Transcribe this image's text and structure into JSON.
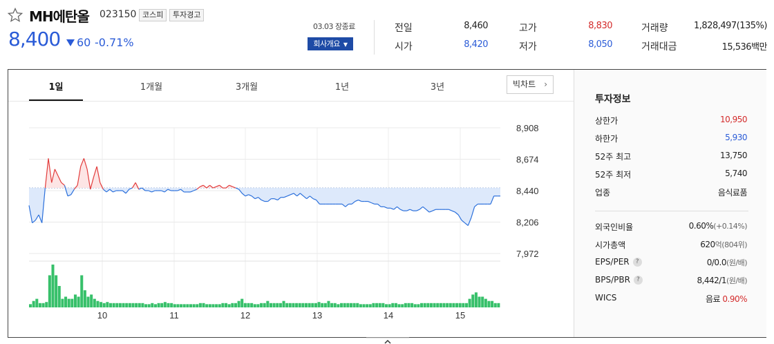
{
  "stock": {
    "name": "MH에탄올",
    "code": "023150",
    "market_tag": "코스피",
    "warning_tag": "투자경고",
    "price": "8,400",
    "change": "60",
    "change_pct": "-0.71%",
    "close_label": "03.03 장종료",
    "company_button": "회사개요"
  },
  "quote": {
    "prev_label": "전일",
    "prev": "8,460",
    "open_label": "시가",
    "open": "8,420",
    "high_label": "고가",
    "high": "8,830",
    "low_label": "저가",
    "low": "8,050",
    "volume_label": "거래량",
    "volume": "1,828,497(135%)",
    "amount_label": "거래대금",
    "amount": "15,536백만"
  },
  "tabs": [
    "1일",
    "1개월",
    "3개월",
    "1년",
    "3년"
  ],
  "big_chart_button": "빅차트",
  "invest": {
    "title": "투자정보",
    "rows": [
      {
        "label": "상한가",
        "value": "10,950"
      },
      {
        "label": "하한가",
        "value": "5,930"
      },
      {
        "label": "52주 최고",
        "value": "13,750"
      },
      {
        "label": "52주 최저",
        "value": "5,740"
      },
      {
        "label": "업종",
        "value": "음식료품"
      },
      {
        "label": "외국인비율",
        "value": "0.60%",
        "sub": "(+0.14%)"
      },
      {
        "label": "시가총액",
        "value": "620",
        "sub": "억(804위)"
      },
      {
        "label": "EPS/PER",
        "value": "0/0.0",
        "sub": "(원/배)"
      },
      {
        "label": "BPS/PBR",
        "value": "8,442/1",
        "sub": "(원/배)"
      },
      {
        "label": "WICS",
        "value": "음료",
        "sub": "0.90%"
      }
    ]
  },
  "chart_data": {
    "type": "line",
    "title": "",
    "xlabel": "",
    "ylabel": "",
    "x_ticks": [
      "10",
      "11",
      "12",
      "13",
      "14",
      "15"
    ],
    "y_ticks": [
      "8,908",
      "8,674",
      "8,440",
      "8,206",
      "7,972"
    ],
    "ylim": [
      7972,
      8908
    ],
    "baseline": 8460,
    "colors": {
      "up": "#e23b3b",
      "down": "#2a6fdb",
      "volume": "#37c06a"
    },
    "series": [
      {
        "name": "",
        "values": [
          8330,
          8200,
          8220,
          8260,
          8200,
          8460,
          8680,
          8500,
          8600,
          8550,
          8500,
          8480,
          8400,
          8410,
          8450,
          8480,
          8620,
          8680,
          8600,
          8450,
          8540,
          8620,
          8500,
          8450,
          8430,
          8450,
          8430,
          8440,
          8440,
          8440,
          8420,
          8450,
          8460,
          8500,
          8450,
          8460,
          8440,
          8440,
          8430,
          8440,
          8440,
          8440,
          8430,
          8450,
          8440,
          8440,
          8440,
          8450,
          8430,
          8430,
          8430,
          8440,
          8450,
          8470,
          8480,
          8460,
          8480,
          8460,
          8470,
          8480,
          8460,
          8460,
          8480,
          8470,
          8460,
          8450,
          8420,
          8400,
          8410,
          8400,
          8380,
          8390,
          8370,
          8360,
          8360,
          8380,
          8380,
          8370,
          8390,
          8390,
          8400,
          8410,
          8420,
          8400,
          8420,
          8400,
          8380,
          8400,
          8380,
          8370,
          8340,
          8340,
          8340,
          8340,
          8340,
          8340,
          8340,
          8340,
          8320,
          8340,
          8340,
          8360,
          8370,
          8360,
          8360,
          8360,
          8350,
          8340,
          8340,
          8320,
          8320,
          8310,
          8310,
          8300,
          8320,
          8300,
          8290,
          8290,
          8300,
          8290,
          8290,
          8300,
          8320,
          8300,
          8280,
          8290,
          8300,
          8300,
          8300,
          8300,
          8300,
          8290,
          8280,
          8260,
          8220,
          8200,
          8180,
          8240,
          8320,
          8340,
          8340,
          8340,
          8340,
          8340,
          8400,
          8400,
          8400
        ]
      },
      {
        "name": "",
        "type": "volume",
        "values": [
          3,
          6,
          8,
          4,
          4,
          5,
          30,
          40,
          30,
          20,
          8,
          10,
          8,
          8,
          12,
          10,
          30,
          16,
          10,
          12,
          8,
          6,
          5,
          4,
          5,
          4,
          4,
          4,
          4,
          4,
          4,
          4,
          4,
          4,
          4,
          4,
          3,
          3,
          4,
          3,
          4,
          4,
          5,
          4,
          4,
          3,
          3,
          3,
          3,
          3,
          3,
          3,
          3,
          4,
          4,
          3,
          3,
          3,
          3,
          3,
          4,
          4,
          3,
          4,
          4,
          6,
          8,
          4,
          4,
          4,
          3,
          3,
          4,
          4,
          6,
          4,
          4,
          4,
          4,
          6,
          4,
          4,
          4,
          4,
          4,
          4,
          4,
          4,
          4,
          4,
          5,
          4,
          4,
          6,
          4,
          4,
          3,
          4,
          4,
          4,
          4,
          4,
          4,
          3,
          3,
          3,
          3,
          4,
          4,
          4,
          4,
          3,
          3,
          4,
          4,
          3,
          3,
          4,
          4,
          4,
          3,
          3,
          4,
          4,
          4,
          4,
          4,
          4,
          4,
          4,
          4,
          4,
          4,
          4,
          4,
          4,
          4,
          8,
          12,
          14,
          10,
          10,
          8,
          6,
          6,
          4,
          4
        ]
      }
    ]
  }
}
